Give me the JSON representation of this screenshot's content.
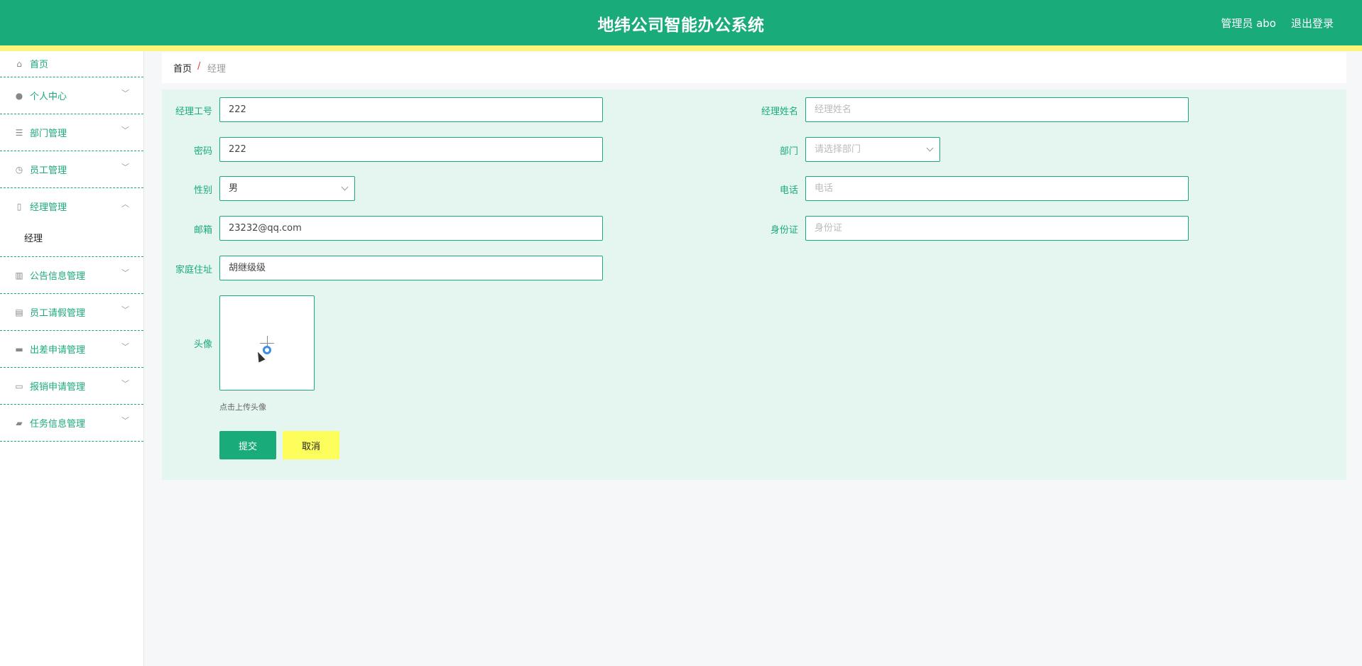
{
  "header": {
    "title": "地纬公司智能办公系统",
    "user": "管理员 abo",
    "logout": "退出登录",
    "colors": {
      "primary": "#1aab7a",
      "accent": "#fdf57a"
    }
  },
  "sidebar": {
    "items": [
      {
        "label": "首页",
        "icon": "home-icon"
      },
      {
        "label": "个人中心",
        "icon": "user-icon"
      },
      {
        "label": "部门管理",
        "icon": "list-icon"
      },
      {
        "label": "员工管理",
        "icon": "clock-icon"
      },
      {
        "label": "经理管理",
        "icon": "mic-icon",
        "sub": "经理"
      },
      {
        "label": "公告信息管理",
        "icon": "bar-chart-icon"
      },
      {
        "label": "员工请假管理",
        "icon": "line-chart-icon"
      },
      {
        "label": "出差申请管理",
        "icon": "suitcase-icon"
      },
      {
        "label": "报销申请管理",
        "icon": "monitor-icon"
      },
      {
        "label": "任务信息管理",
        "icon": "ticket-icon"
      }
    ]
  },
  "breadcrumb": {
    "home": "首页",
    "separator": "/",
    "current": "经理"
  },
  "form": {
    "manager_id": {
      "label": "经理工号",
      "value": "222"
    },
    "manager_name": {
      "label": "经理姓名",
      "placeholder": "经理姓名"
    },
    "password": {
      "label": "密码",
      "value": "222"
    },
    "department": {
      "label": "部门",
      "placeholder": "请选择部门"
    },
    "gender": {
      "label": "性别",
      "value": "男"
    },
    "phone": {
      "label": "电话",
      "placeholder": "电话"
    },
    "email": {
      "label": "邮箱",
      "value": "23232@qq.com"
    },
    "id_card": {
      "label": "身份证",
      "placeholder": "身份证"
    },
    "address": {
      "label": "家庭住址",
      "value": "胡继级级"
    },
    "avatar": {
      "label": "头像",
      "hint": "点击上传头像"
    },
    "submit": "提交",
    "cancel": "取消"
  }
}
